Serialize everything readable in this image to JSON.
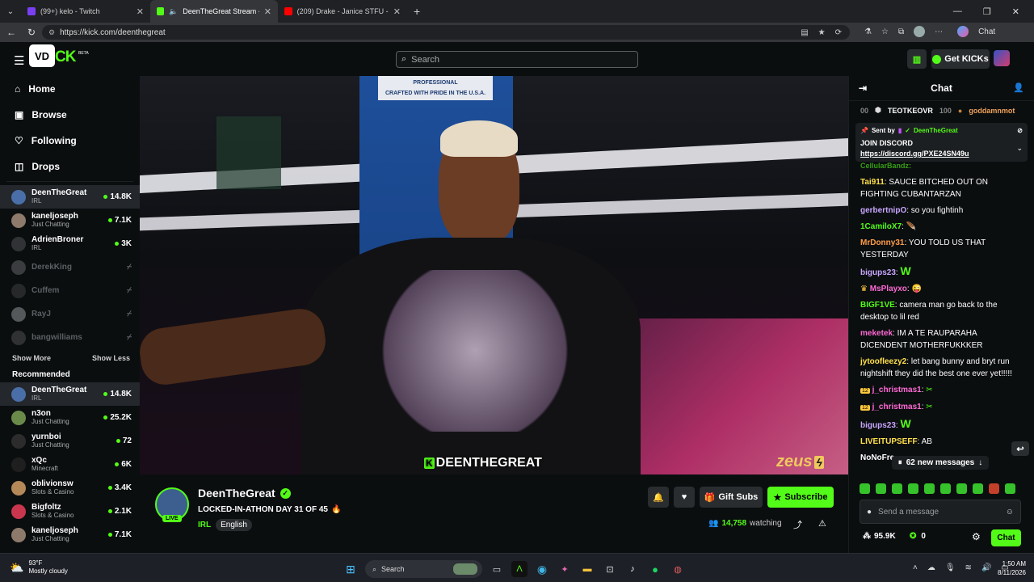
{
  "browser": {
    "tabs": [
      {
        "label": "(99+) kelo - Twitch",
        "active": false
      },
      {
        "label": "DeenTheGreat Stream - Watch",
        "active": true
      },
      {
        "label": "(209) Drake - Janice STFU - YouTu",
        "active": false
      }
    ],
    "url": "https://kick.com/deenthegreat",
    "profile_chat_label": "Chat"
  },
  "header": {
    "search_placeholder": "Search",
    "get_kicks_label": "Get KICKs",
    "logo_badge": "BETA"
  },
  "sidebar": {
    "nav": [
      {
        "label": "Home",
        "icon": "home-icon"
      },
      {
        "label": "Browse",
        "icon": "browse-icon"
      },
      {
        "label": "Following",
        "icon": "heart-icon"
      },
      {
        "label": "Drops",
        "icon": "drops-icon"
      }
    ],
    "following": [
      {
        "name": "DeenTheGreat",
        "category": "IRL",
        "viewers": "14.8K",
        "live": true
      },
      {
        "name": "kaneljoseph",
        "category": "Just Chatting",
        "viewers": "7.1K",
        "live": true
      },
      {
        "name": "AdrienBroner",
        "category": "IRL",
        "viewers": "3K",
        "live": true
      },
      {
        "name": "DerekKing",
        "category": "",
        "viewers": "",
        "live": false
      },
      {
        "name": "Cuffem",
        "category": "",
        "viewers": "",
        "live": false
      },
      {
        "name": "RayJ",
        "category": "",
        "viewers": "",
        "live": false
      },
      {
        "name": "bangwilliams",
        "category": "",
        "viewers": "",
        "live": false
      }
    ],
    "show_more": "Show More",
    "show_less": "Show Less",
    "recommended_title": "Recommended",
    "recommended": [
      {
        "name": "DeenTheGreat",
        "category": "IRL",
        "viewers": "14.8K"
      },
      {
        "name": "n3on",
        "category": "Just Chatting",
        "viewers": "25.2K"
      },
      {
        "name": "yurnboi",
        "category": "Just Chatting",
        "viewers": "72"
      },
      {
        "name": "xQc",
        "category": "Minecraft",
        "viewers": "6K"
      },
      {
        "name": "oblivionsw",
        "category": "Slots & Casino",
        "viewers": "3.4K"
      },
      {
        "name": "Bigfoltz",
        "category": "Slots & Casino",
        "viewers": "2.1K"
      },
      {
        "name": "kaneljoseph",
        "category": "Just Chatting",
        "viewers": "7.1K"
      }
    ]
  },
  "video": {
    "overlay_name": "DEENTHEGREAT",
    "watermark": "zeus",
    "banner_text": "CRAFTED WITH PRIDE IN THE U.S.A.",
    "banner_top": "PROFESSIONAL"
  },
  "stream": {
    "channel": "DeenTheGreat",
    "live_badge": "LIVE",
    "title": "LOCKED-IN-ATHON DAY 31 OF 45",
    "category": "IRL",
    "language": "English",
    "gift_subs": "Gift Subs",
    "subscribe": "Subscribe",
    "viewers": "14,758",
    "watching_label": "watching"
  },
  "chat": {
    "title": "Chat",
    "leaderboard": [
      {
        "rank": "00",
        "name": ""
      },
      {
        "rank": "",
        "name": "TEOTKEOVR",
        "score": "100"
      },
      {
        "rank": "",
        "name": "goddamnmot",
        "score": ""
      }
    ],
    "pinned": {
      "sent_by_label": "Sent by",
      "sender": "DeenTheGreat",
      "line1": "JOIN DISCORD",
      "link": "https://discord.gg/PXE24SN49u"
    },
    "partial_user": "CellularBandz:",
    "messages": [
      {
        "user": "Tai911",
        "color": "#ffe04a",
        "text": "SAUCE BITCHED OUT ON FIGHTING CUBANTARZAN"
      },
      {
        "user": "gerbertnipO",
        "color": "#c8a6ff",
        "text": "so you fightinh"
      },
      {
        "user": "1CamiloX7",
        "color": "#53fc18",
        "text": ""
      },
      {
        "user": "MrDonny31",
        "color": "#ff9d4a",
        "text": "YOU TOLD US THAT YESTERDAY"
      },
      {
        "user": "bigups23",
        "color": "#c8a6ff",
        "text": "W"
      },
      {
        "user": "MsPlayxo",
        "color": "#ff6ad5",
        "text": ""
      },
      {
        "user": "BIGF1VE",
        "color": "#53fc18",
        "text": "camera man go back to the desktop to lil red"
      },
      {
        "user": "meketek",
        "color": "#ff6ad5",
        "text": "IM A TE RAUPARAHA DICENDENT MOTHERFUKKKER"
      },
      {
        "user": "jytoofleezy2",
        "color": "#ffe04a",
        "text": "let bang bunny and bryt run nightshift they did the best one ever yet!!!!!"
      },
      {
        "user": "j_christmas1",
        "color": "#ff6ad5",
        "text": ""
      },
      {
        "user": "j_christmas1",
        "color": "#ff6ad5",
        "text": ""
      },
      {
        "user": "bigups23",
        "color": "#c8a6ff",
        "text": "W"
      },
      {
        "user": "LIVEITUPSEFF",
        "color": "#ffe04a",
        "text": "AB"
      }
    ],
    "partial_last": "NoNoFre",
    "new_messages": "62 new messages",
    "input_placeholder": "Send a message",
    "kicks_count": "95.9K",
    "points": "0",
    "chat_button": "Chat"
  },
  "taskbar": {
    "weather_temp": "93°F",
    "weather_desc": "Mostly cloudy",
    "search_label": "Search",
    "time": "1:50 AM",
    "date": "8/11/2026"
  },
  "colors": {
    "kick_green": "#53fc18",
    "bg": "#0b0e0f"
  }
}
